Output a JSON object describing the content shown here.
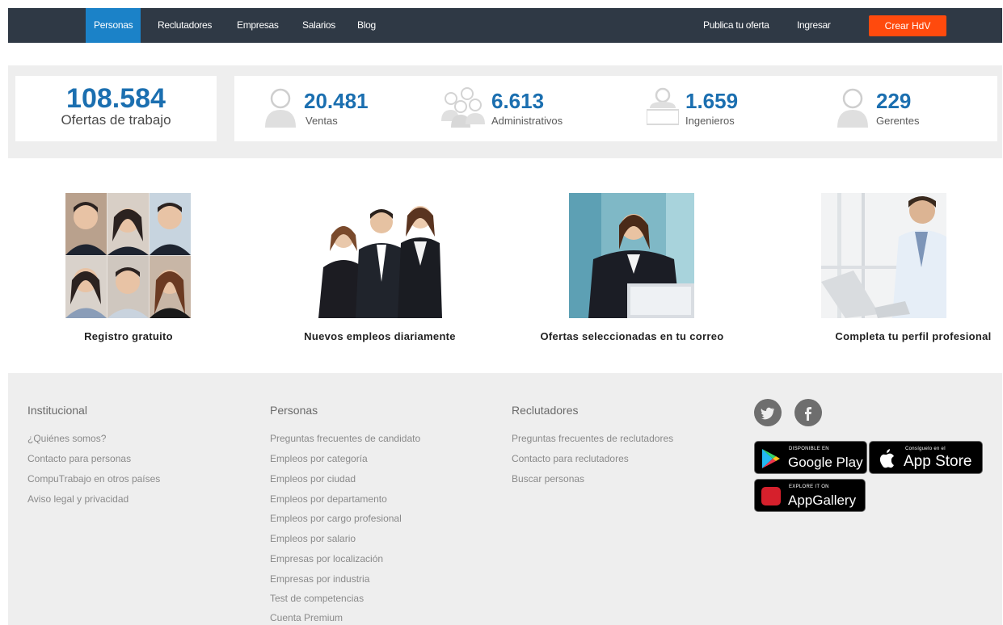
{
  "nav": {
    "left": [
      "Personas",
      "Reclutadores",
      "Empresas",
      "Salarios",
      "Blog"
    ],
    "post_offer": "Publica tu oferta",
    "login": "Ingresar",
    "cta": "Crear HdV"
  },
  "stats": {
    "total": {
      "value": "108.584",
      "label": "Ofertas de trabajo"
    },
    "categories": [
      {
        "value": "20.481",
        "label": "Ventas",
        "icon": "person-icon"
      },
      {
        "value": "6.613",
        "label": "Administrativos",
        "icon": "group-icon"
      },
      {
        "value": "1.659",
        "label": "Ingenieros",
        "icon": "engineer-icon"
      },
      {
        "value": "229",
        "label": "Gerentes",
        "icon": "manager-icon"
      }
    ]
  },
  "features": [
    "Registro gratuito",
    "Nuevos empleos diariamente",
    "Ofertas seleccionadas en tu correo",
    "Completa tu perfil profesional"
  ],
  "footer": {
    "institucional": {
      "title": "Institucional",
      "links": [
        "¿Quiénes somos?",
        "Contacto para personas",
        "CompuTrabajo en otros países",
        "Aviso legal y privacidad"
      ]
    },
    "personas": {
      "title": "Personas",
      "links": [
        "Preguntas frecuentes de candidato",
        "Empleos por categoría",
        "Empleos por ciudad",
        "Empleos por departamento",
        "Empleos por cargo profesional",
        "Empleos por salario",
        "Empresas por localización",
        "Empresas por industria",
        "Test de competencias",
        "Cuenta Premium"
      ]
    },
    "reclutadores": {
      "title": "Reclutadores",
      "links": [
        "Preguntas frecuentes de reclutadores",
        "Contacto para reclutadores",
        "Buscar personas"
      ]
    },
    "social": {
      "twitter": "twitter-icon",
      "facebook": "facebook-icon"
    },
    "apps": {
      "google_small": "DISPONIBLE EN",
      "google_big": "Google Play",
      "apple_small": "Consíguelo en el",
      "apple_big": "App Store",
      "huawei_small": "EXPLORE IT ON",
      "huawei_big": "AppGallery"
    }
  },
  "colors": {
    "nav_bg": "#2f3945",
    "active": "#1b82c8",
    "cta": "#ff4a0d",
    "accent_number": "#1b6fb0"
  }
}
